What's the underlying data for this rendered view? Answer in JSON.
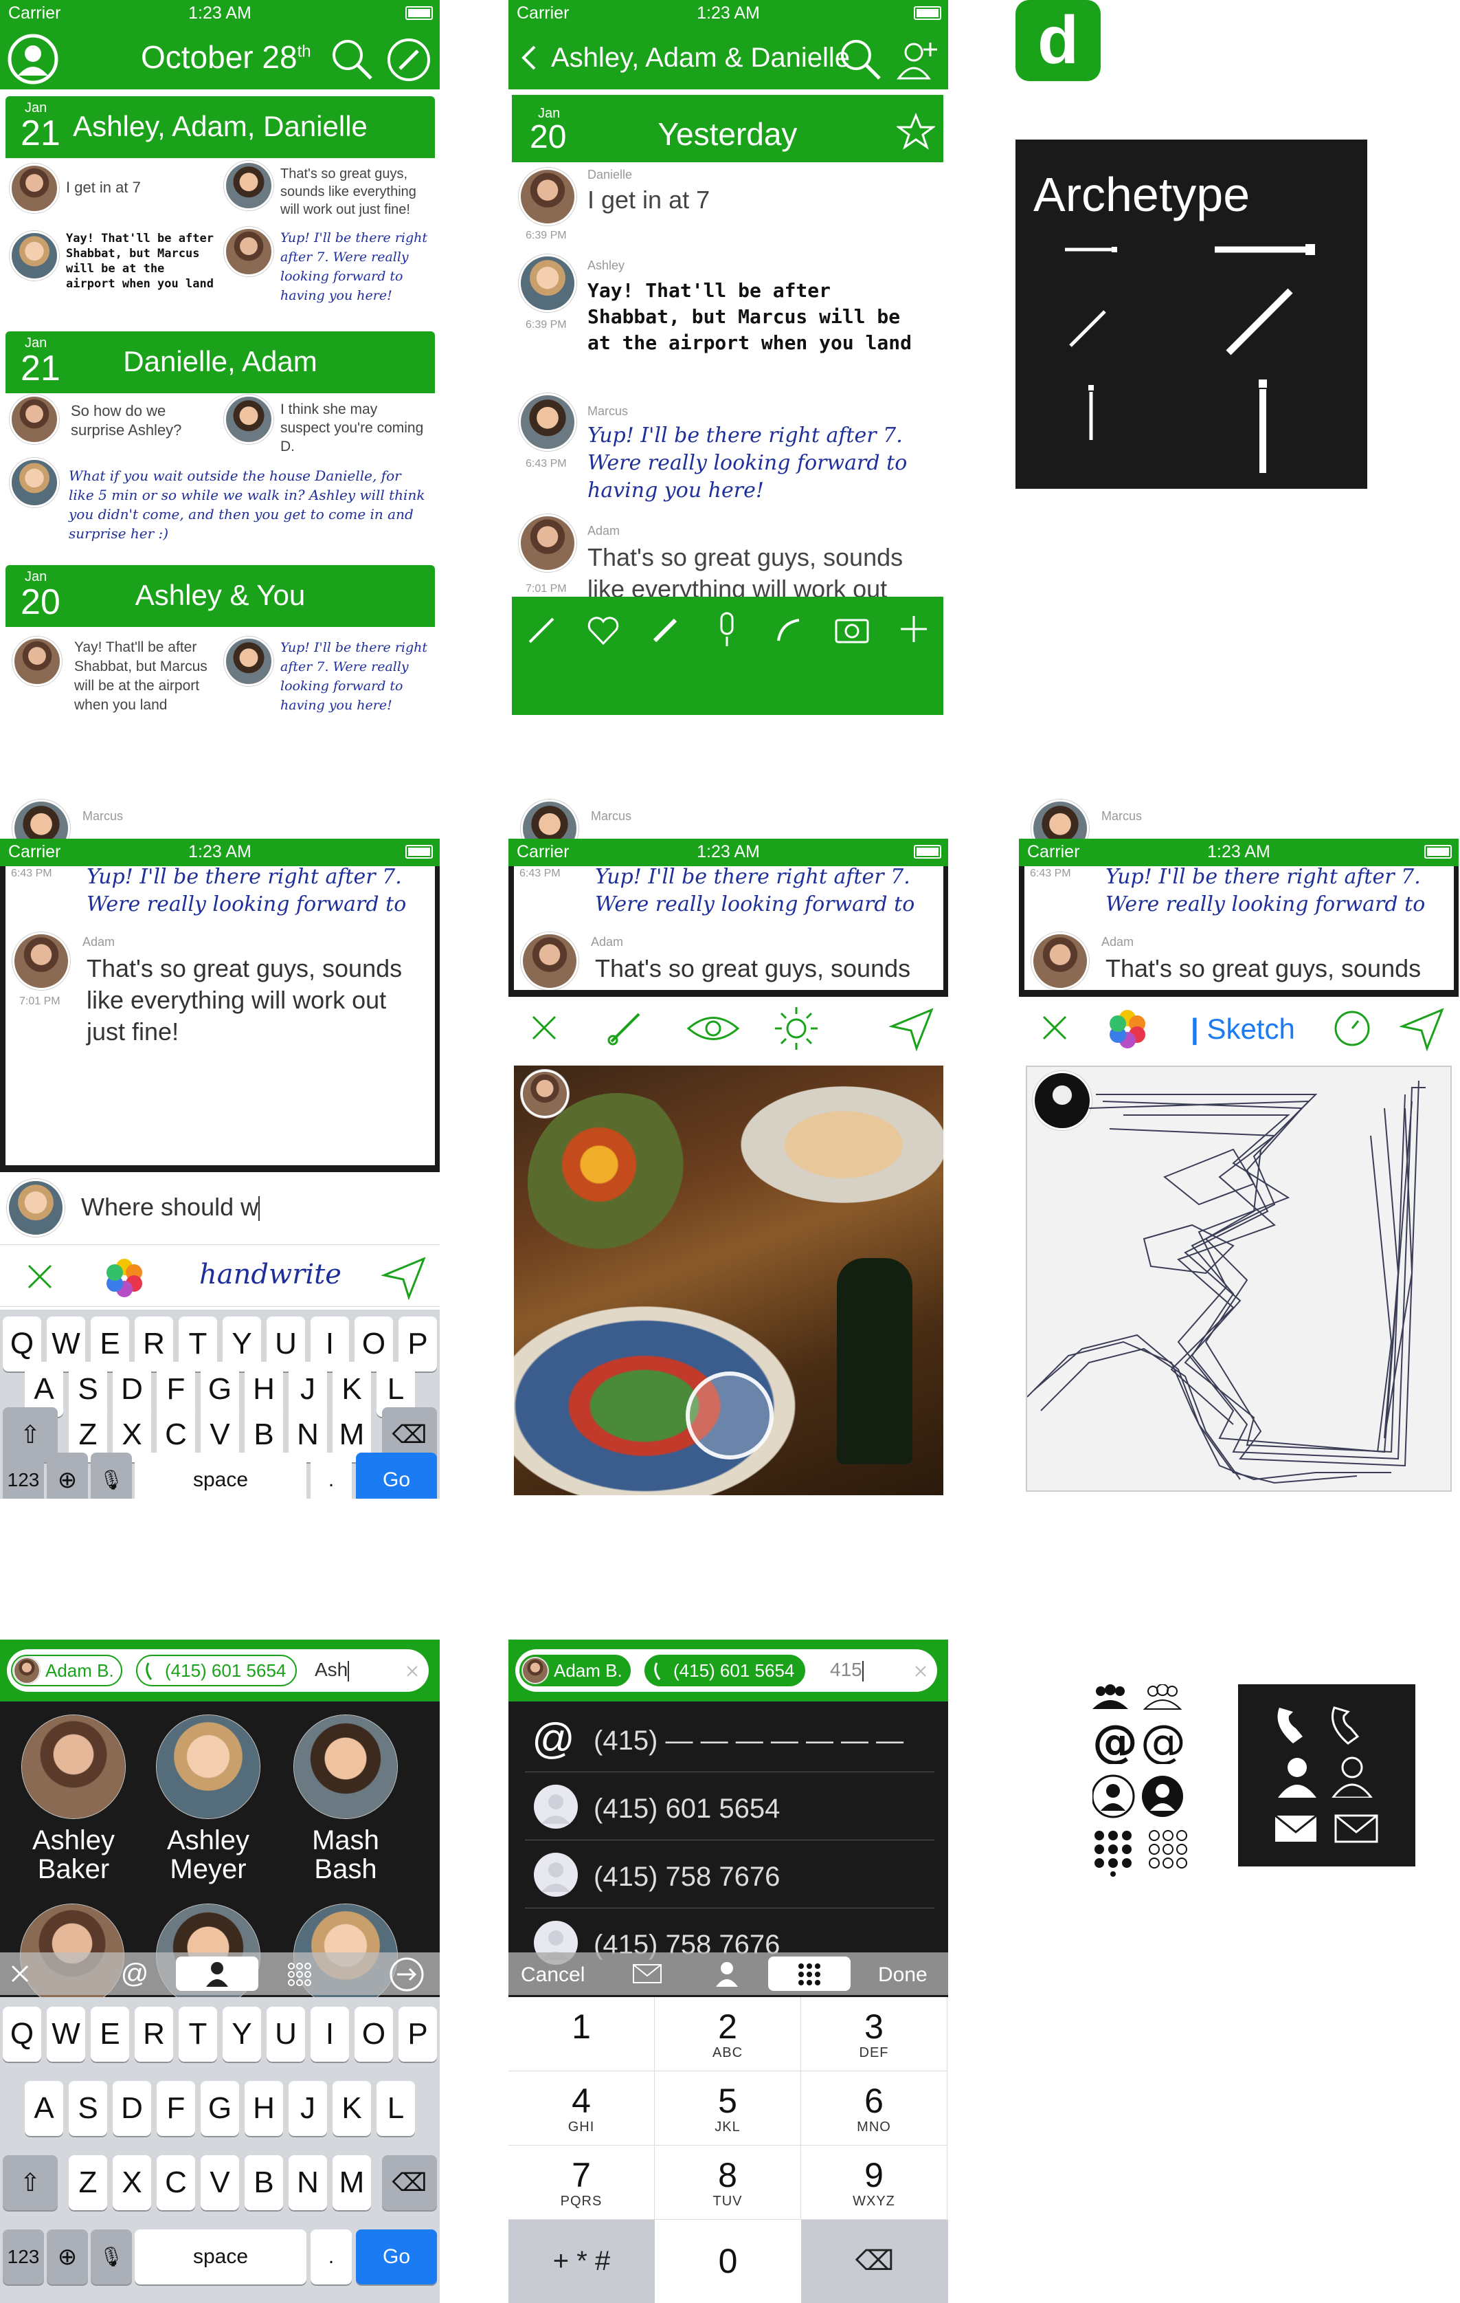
{
  "status": {
    "carrier": "Carrier",
    "time": "1:23 AM"
  },
  "screen1": {
    "date_title": "October 28",
    "date_sup": "th",
    "cards": [
      {
        "month": "Jan",
        "day": "21",
        "title": "Ashley, Adam, Danielle",
        "msg_left_1": "I get in at 7",
        "msg_right_1": "That's so great guys, sounds like everything will work out just fine!",
        "msg_left_2": "Yay! That'll be after Shabbat, but Marcus will be at the airport when you land",
        "msg_right_2": "Yup! I'll be there right after 7. Were really looking forward to having you here!"
      },
      {
        "month": "Jan",
        "day": "21",
        "title": "Danielle, Adam",
        "msg_left_1": "So how do we surprise Ashley?",
        "msg_right_1": "I think she may suspect you're coming D.",
        "msg_left_2": "What if you wait outside the house Danielle, for like 5 min or so while we walk in? Ashley will think you didn't come, and then you get to come in and surprise her :)"
      },
      {
        "month": "Jan",
        "day": "20",
        "title": "Ashley & You",
        "msg_left_1": "Yay! That'll be after Shabbat, but Marcus will be at the airport when you land",
        "msg_right_1": "Yup! I'll be there right after 7. Were really looking forward to having you here!"
      }
    ]
  },
  "screen2": {
    "nav_title": "Ashley, Adam & Danielle",
    "day_header": {
      "month": "Jan",
      "day": "20",
      "title": "Yesterday"
    },
    "messages": [
      {
        "sender": "Danielle",
        "time": "6:39 PM",
        "text": "I get in at 7"
      },
      {
        "sender": "Ashley",
        "time": "6:39 PM",
        "text": "Yay! That'll be after Shabbat, but Marcus will be at the airport when you land"
      },
      {
        "sender": "Marcus",
        "time": "6:43 PM",
        "text": "Yup! I'll be there right after 7. Were really looking forward to having you here!"
      },
      {
        "sender": "Adam",
        "time": "7:01 PM",
        "text": "That's so great guys, sounds like everything will work out just"
      }
    ]
  },
  "logo": {
    "letter": "d"
  },
  "archetype": {
    "title": "Archetype"
  },
  "compose": {
    "marcus": "Marcus",
    "marcus_text": "Yup! I'll be there right after 7. Were really looking forward to having you here!",
    "marcus_time": "6:43 PM",
    "adam": "Adam",
    "adam_text": "That's so great guys, sounds like everything will work out just fine!",
    "adam_time": "7:01 PM",
    "input": "Where should w",
    "handwrite": "handwrite",
    "sketch": "Sketch",
    "space": "space",
    "go": "Go",
    "n123": "123",
    "dot": "."
  },
  "keyboard": {
    "row1": [
      "Q",
      "W",
      "E",
      "R",
      "T",
      "Y",
      "U",
      "I",
      "O",
      "P"
    ],
    "row2": [
      "A",
      "S",
      "D",
      "F",
      "G",
      "H",
      "J",
      "K",
      "L"
    ],
    "row3": [
      "Z",
      "X",
      "C",
      "V",
      "B",
      "N",
      "M"
    ]
  },
  "contacts": {
    "chip1": "Adam B.",
    "chip2": "(415) 601 5654",
    "typed": "Ash",
    "people": [
      {
        "first": "Ashley",
        "last": "Baker"
      },
      {
        "first": "Ashley",
        "last": "Meyer"
      },
      {
        "first": "Mash",
        "last": "Bash"
      }
    ]
  },
  "dialer": {
    "chip1": "Adam B.",
    "chip2": "(415) 601 5654",
    "typed": "415",
    "rows": [
      "(415) — — — — — — —",
      "(415) 601 5654",
      "(415) 758 7676",
      "(415) 758 7676"
    ],
    "cancel": "Cancel",
    "done": "Done",
    "keys": [
      {
        "n": "1",
        "l": ""
      },
      {
        "n": "2",
        "l": "ABC"
      },
      {
        "n": "3",
        "l": "DEF"
      },
      {
        "n": "4",
        "l": "GHI"
      },
      {
        "n": "5",
        "l": "JKL"
      },
      {
        "n": "6",
        "l": "MNO"
      },
      {
        "n": "7",
        "l": "PQRS"
      },
      {
        "n": "8",
        "l": "TUV"
      },
      {
        "n": "9",
        "l": "WXYZ"
      }
    ],
    "sym": "+ * #",
    "zero": "0"
  },
  "colors": {
    "green": "#1aa31a",
    "dark": "#1a1a1a",
    "handwriting": "#1f2f9a",
    "go_blue": "#1a7bf2"
  }
}
